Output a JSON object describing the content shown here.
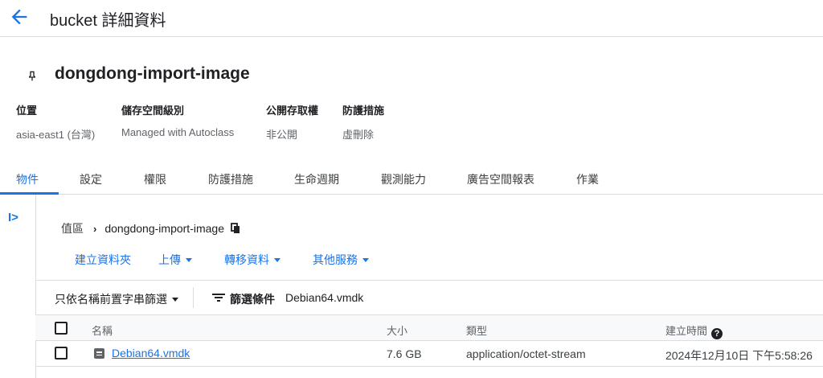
{
  "header": {
    "title": "bucket 詳細資料",
    "back_icon": "arrow-back-icon"
  },
  "bucket": {
    "name": "dongdong-import-image",
    "icon": "pin-icon",
    "meta": [
      {
        "label": "位置",
        "value": "asia-east1 (台灣)"
      },
      {
        "label": "儲存空間級別",
        "value": "Managed with Autoclass"
      },
      {
        "label": "公開存取權",
        "value": "非公開"
      },
      {
        "label": "防護措施",
        "value": "虛刪除"
      }
    ]
  },
  "tabs": [
    "物件",
    "設定",
    "權限",
    "防護措施",
    "生命週期",
    "觀測能力",
    "廣告空間報表",
    "作業"
  ],
  "active_tab": "物件",
  "breadcrumb": {
    "root": "值區",
    "current": "dongdong-import-image"
  },
  "actions": {
    "create_folder": "建立資料夾",
    "upload": "上傳",
    "transfer": "轉移資料",
    "other_services": "其他服務"
  },
  "filter": {
    "prefix_label": "只依名稱前置字串篩選",
    "filter_label": "篩選條件",
    "filter_value": "Debian64.vmdk"
  },
  "table": {
    "columns": {
      "name": "名稱",
      "size": "大小",
      "type": "類型",
      "created": "建立時間"
    },
    "rows": [
      {
        "name": "Debian64.vmdk",
        "size": "7.6 GB",
        "type": "application/octet-stream",
        "created": "2024年12月10日 下午5:58:26"
      }
    ]
  },
  "colors": {
    "accent": "#1a73e8",
    "text": "#202124",
    "muted": "#5f6368",
    "divider": "#dadce0"
  }
}
